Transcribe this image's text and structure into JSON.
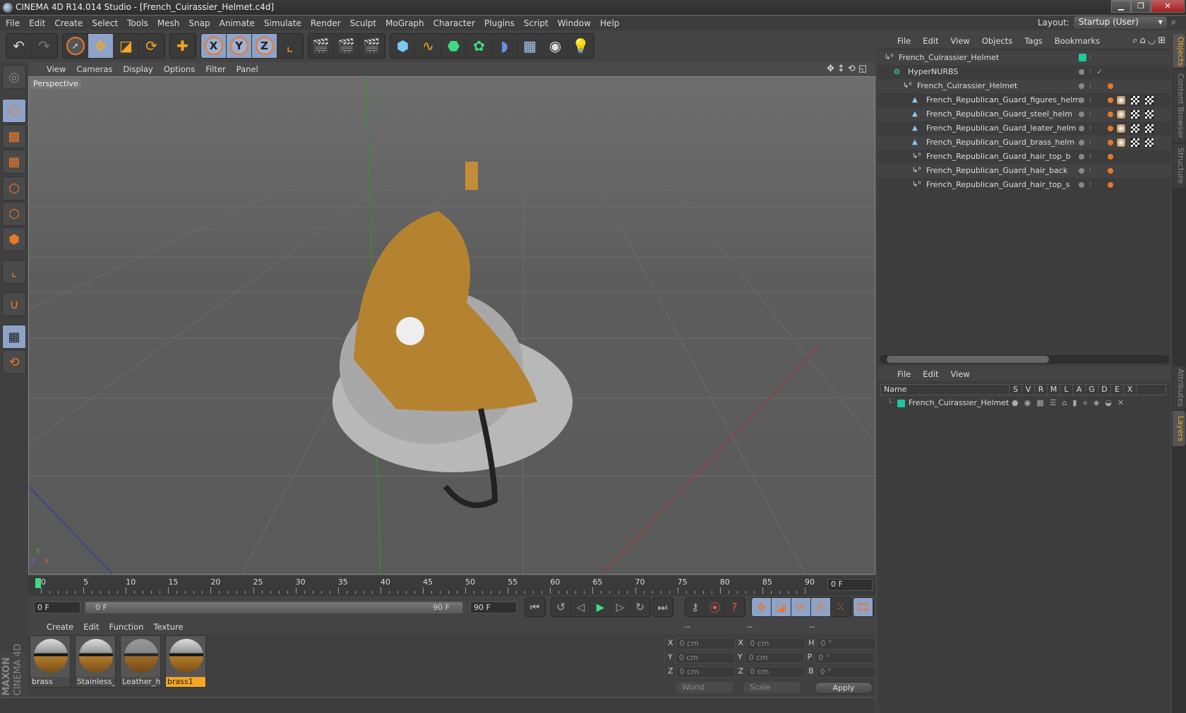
{
  "window": {
    "title": "CINEMA 4D R14.014 Studio - [French_Cuirassier_Helmet.c4d]",
    "controls": [
      "minimize",
      "restore",
      "close"
    ]
  },
  "menubar": [
    "File",
    "Edit",
    "Create",
    "Select",
    "Tools",
    "Mesh",
    "Snap",
    "Animate",
    "Simulate",
    "Render",
    "Sculpt",
    "MoGraph",
    "Character",
    "Plugins",
    "Script",
    "Window",
    "Help"
  ],
  "layout": {
    "label": "Layout:",
    "value": "Startup (User)"
  },
  "toolbar": {
    "groups": [
      [
        "undo-icon",
        "redo-icon"
      ],
      [
        "live-selection-icon",
        "move-icon",
        "scale-icon",
        "rotate-icon"
      ],
      [
        "add-icon"
      ],
      [
        "x-axis-icon",
        "y-axis-icon",
        "z-axis-icon",
        "coordinate-system-icon"
      ],
      [
        "render-view-icon",
        "render-picture-viewer-icon",
        "render-settings-icon"
      ],
      [
        "cube-icon",
        "spline-icon",
        "nurbs-icon",
        "array-icon",
        "deformer-icon",
        "floor-icon",
        "camera-icon",
        "light-icon"
      ]
    ],
    "axis_labels": [
      "X",
      "Y",
      "Z"
    ]
  },
  "left_tools": [
    "make-editable",
    "model-mode",
    "texture-mode",
    "workplane-mode",
    "points-mode",
    "edges-mode",
    "polygons-mode",
    "axis-mode",
    "snap",
    "locked-workplane",
    "workplane-sync"
  ],
  "viewport": {
    "menu": [
      "View",
      "Cameras",
      "Display",
      "Options",
      "Filter",
      "Panel"
    ],
    "label": "Perspective",
    "axis_gizmo": [
      "Y",
      "Z",
      "X"
    ]
  },
  "timeline": {
    "ticks": [
      "0",
      "5",
      "10",
      "15",
      "20",
      "25",
      "30",
      "35",
      "40",
      "45",
      "50",
      "55",
      "60",
      "65",
      "70",
      "75",
      "80",
      "85",
      "90"
    ],
    "current_frame": "0 F",
    "start_field": "0 F",
    "range_start": "0 F",
    "range_end": "90 F",
    "end_field": "90 F"
  },
  "transport": {
    "buttons": [
      "go-to-start",
      "previous-key",
      "play-backwards",
      "play",
      "next-frame",
      "next-key",
      "go-to-end"
    ],
    "record": [
      "autokey",
      "record",
      "help"
    ],
    "key_types": [
      "move",
      "scale",
      "rotate",
      "parameter",
      "point-level-animation",
      "timeline"
    ]
  },
  "material_manager": {
    "menu": [
      "Create",
      "Edit",
      "Function",
      "Texture"
    ],
    "materials": [
      {
        "name": "brass",
        "selected": false
      },
      {
        "name": "Stainless_S",
        "selected": false
      },
      {
        "name": "Leather_hlr",
        "selected": false
      },
      {
        "name": "brass1",
        "selected": true
      }
    ]
  },
  "branding": {
    "line1": "MAXON",
    "line2": "CINEMA 4D"
  },
  "coordinates": {
    "headers": [
      "--",
      "--",
      "--"
    ],
    "rows": [
      {
        "a_label": "X",
        "a": "0 cm",
        "b_label": "X",
        "b": "0 cm",
        "c_label": "H",
        "c": "0 °"
      },
      {
        "a_label": "Y",
        "a": "0 cm",
        "b_label": "Y",
        "b": "0 cm",
        "c_label": "P",
        "c": "0 °"
      },
      {
        "a_label": "Z",
        "a": "0 cm",
        "b_label": "Z",
        "b": "0 cm",
        "c_label": "B",
        "c": "0 °"
      }
    ],
    "mode": "World",
    "type": "Scale",
    "apply": "Apply"
  },
  "object_manager": {
    "menu": [
      "File",
      "Edit",
      "View",
      "Objects",
      "Tags",
      "Bookmarks"
    ],
    "objects": [
      {
        "name": "French_Cuirassier_Helmet",
        "type": "null",
        "depth": 0,
        "tags": 0
      },
      {
        "name": "HyperNURBS",
        "type": "hypernurbs",
        "depth": 1,
        "tags": 0
      },
      {
        "name": "French_Cuirassier_Helmet",
        "type": "null",
        "depth": 2,
        "tags": 1
      },
      {
        "name": "French_Republican_Guard_figures_helm",
        "type": "polygon",
        "depth": 3,
        "tags": 4
      },
      {
        "name": "French_Republican_Guard_steel_helm",
        "type": "polygon",
        "depth": 3,
        "tags": 4
      },
      {
        "name": "French_Republican_Guard_leater_helm",
        "type": "polygon",
        "depth": 3,
        "tags": 4
      },
      {
        "name": "French_Republican_Guard_brass_helm",
        "type": "polygon",
        "depth": 3,
        "tags": 4
      },
      {
        "name": "French_Republican_Guard_hair_top_b",
        "type": "null",
        "depth": 3,
        "tags": 1
      },
      {
        "name": "French_Republican_Guard_hair_back",
        "type": "null",
        "depth": 3,
        "tags": 1
      },
      {
        "name": "French_Republican_Guard_hair_top_s",
        "type": "null",
        "depth": 3,
        "tags": 1
      }
    ]
  },
  "layer_manager": {
    "menu": [
      "File",
      "Edit",
      "View"
    ],
    "columns": [
      "Name",
      "S",
      "V",
      "R",
      "M",
      "L",
      "A",
      "G",
      "D",
      "E",
      "X"
    ],
    "layers": [
      {
        "name": "French_Cuirassier_Helmet",
        "color": "#1ec8a0"
      }
    ]
  },
  "side_tabs": [
    {
      "label": "Objects",
      "active": true
    },
    {
      "label": "Content Browser",
      "active": false
    },
    {
      "label": "Structure",
      "active": false
    },
    {
      "label": "Attributes",
      "active": false
    },
    {
      "label": "Layers",
      "active": true
    }
  ],
  "colors": {
    "accent": "#f5a623",
    "selection": "#8ea3c8",
    "layer": "#1ec8a0",
    "play": "#3ddc84"
  }
}
